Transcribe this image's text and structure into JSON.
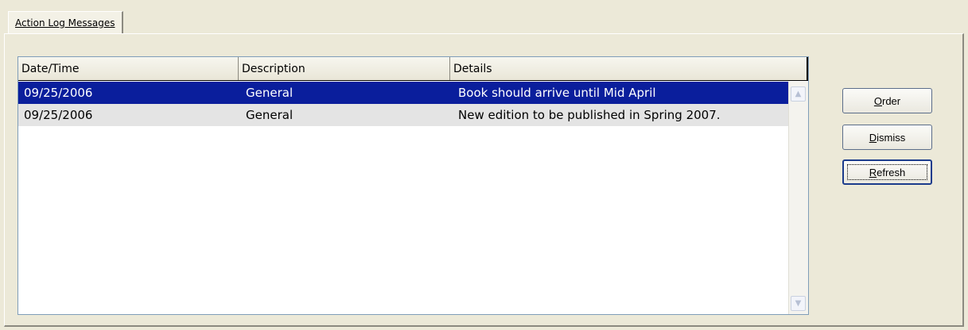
{
  "tabs": [
    {
      "label": "Action Log Messages",
      "active": true
    }
  ],
  "grid": {
    "columns": [
      "Date/Time",
      "Description",
      "Details"
    ],
    "rows": [
      {
        "date": "09/25/2006",
        "description": "General",
        "details": "Book should arrive until Mid April",
        "selected": true
      },
      {
        "date": "09/25/2006",
        "description": "General",
        "details": "New edition to be published in Spring 2007.",
        "selected": false
      }
    ]
  },
  "buttons": {
    "order": {
      "mnemonic": "O",
      "rest": "rder"
    },
    "dismiss": {
      "mnemonic": "D",
      "rest": "ismiss"
    },
    "refresh": {
      "mnemonic": "R",
      "rest": "efresh",
      "focused": true
    }
  },
  "scrollbar": {
    "up_icon": "chevron-up-icon",
    "down_icon": "chevron-down-icon"
  },
  "colors": {
    "selection": "#0a1e9c",
    "alternate_row": "#e4e4e4",
    "window_background": "#ece9d8"
  }
}
